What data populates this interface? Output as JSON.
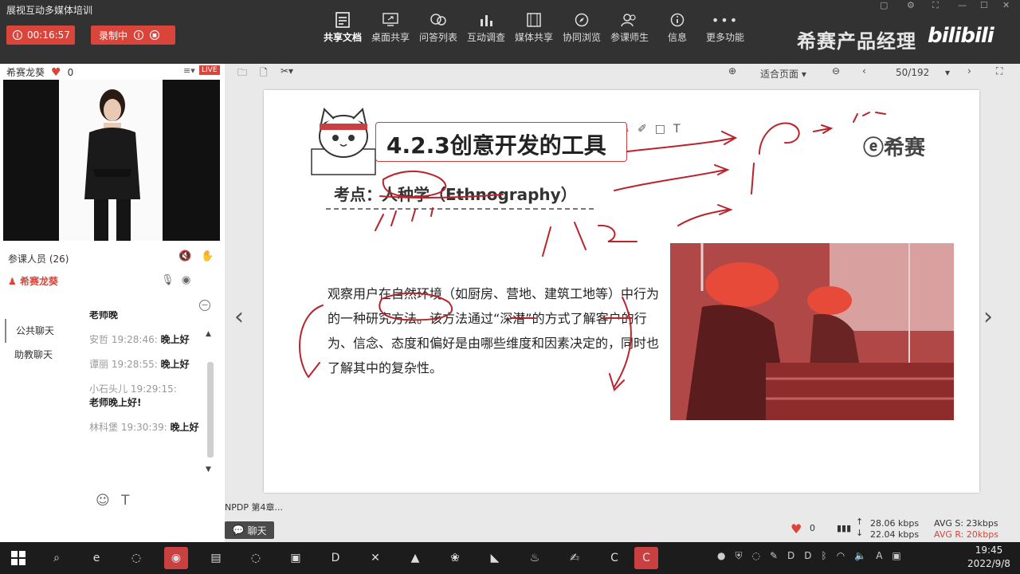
{
  "app": {
    "title": "展视互动多媒体培训"
  },
  "recording": {
    "timer": "00:16:57",
    "status": "录制中"
  },
  "toolbar": {
    "items": [
      {
        "label": "共享文档",
        "icon": "document-share-icon",
        "active": true
      },
      {
        "label": "桌面共享",
        "icon": "desktop-share-icon"
      },
      {
        "label": "问答列表",
        "icon": "qa-list-icon"
      },
      {
        "label": "互动调查",
        "icon": "survey-chart-icon"
      },
      {
        "label": "媒体共享",
        "icon": "media-film-icon"
      },
      {
        "label": "协同浏览",
        "icon": "compass-icon"
      },
      {
        "label": "参课师生",
        "icon": "people-icon"
      },
      {
        "label": "信息",
        "icon": "info-icon"
      },
      {
        "label": "更多功能",
        "icon": "more-dots-icon"
      }
    ]
  },
  "brand": {
    "name": "希赛产品经理",
    "platform": "bilibili"
  },
  "teacher": {
    "name": "希赛龙葵",
    "likes": "0",
    "live_badge": "LIVE"
  },
  "participants": {
    "label": "参课人员 (26)",
    "host": "希赛龙葵"
  },
  "chat": {
    "tabs": [
      "公共聊天",
      "助教聊天"
    ],
    "partial_top": "老师晚",
    "messages": [
      {
        "name": "安哲",
        "time": "19:28:46:",
        "text": "晚上好"
      },
      {
        "name": "谭丽",
        "time": "19:28:55:",
        "text": "晚上好"
      },
      {
        "name": "小石头儿",
        "time": "19:29:15:",
        "text": "老师晚上好!"
      },
      {
        "name": "林科堡",
        "time": "19:30:39:",
        "text": "晚上好"
      }
    ],
    "chat_button": "聊天"
  },
  "document": {
    "zoom": "适合页面",
    "page": "50/192",
    "title": "4.2.3创意开发的工具",
    "logo": "希赛",
    "kaodian": "考点：人种学（Ethnography）",
    "body": "观察用户在自然环境（如厨房、营地、建筑工地等）中行为的一种研究方法。该方法通过“深潜”的方式了解客户的行为、信念、态度和偏好是由哪些维度和因素决定的，同时也了解其中的复杂性。",
    "chapter": "NPDP 第4章..."
  },
  "stats": {
    "likes": "0",
    "up": "28.06 kbps",
    "down": "22.04 kbps",
    "avg_s": "AVG S: 23kbps",
    "avg_r": "AVG R: 20kbps"
  },
  "taskbar": {
    "time": "19:45",
    "date": "2022/9/8"
  },
  "colors": {
    "accent_red": "#d9453a",
    "ink": "#b8242c",
    "topbar": "#323232"
  }
}
